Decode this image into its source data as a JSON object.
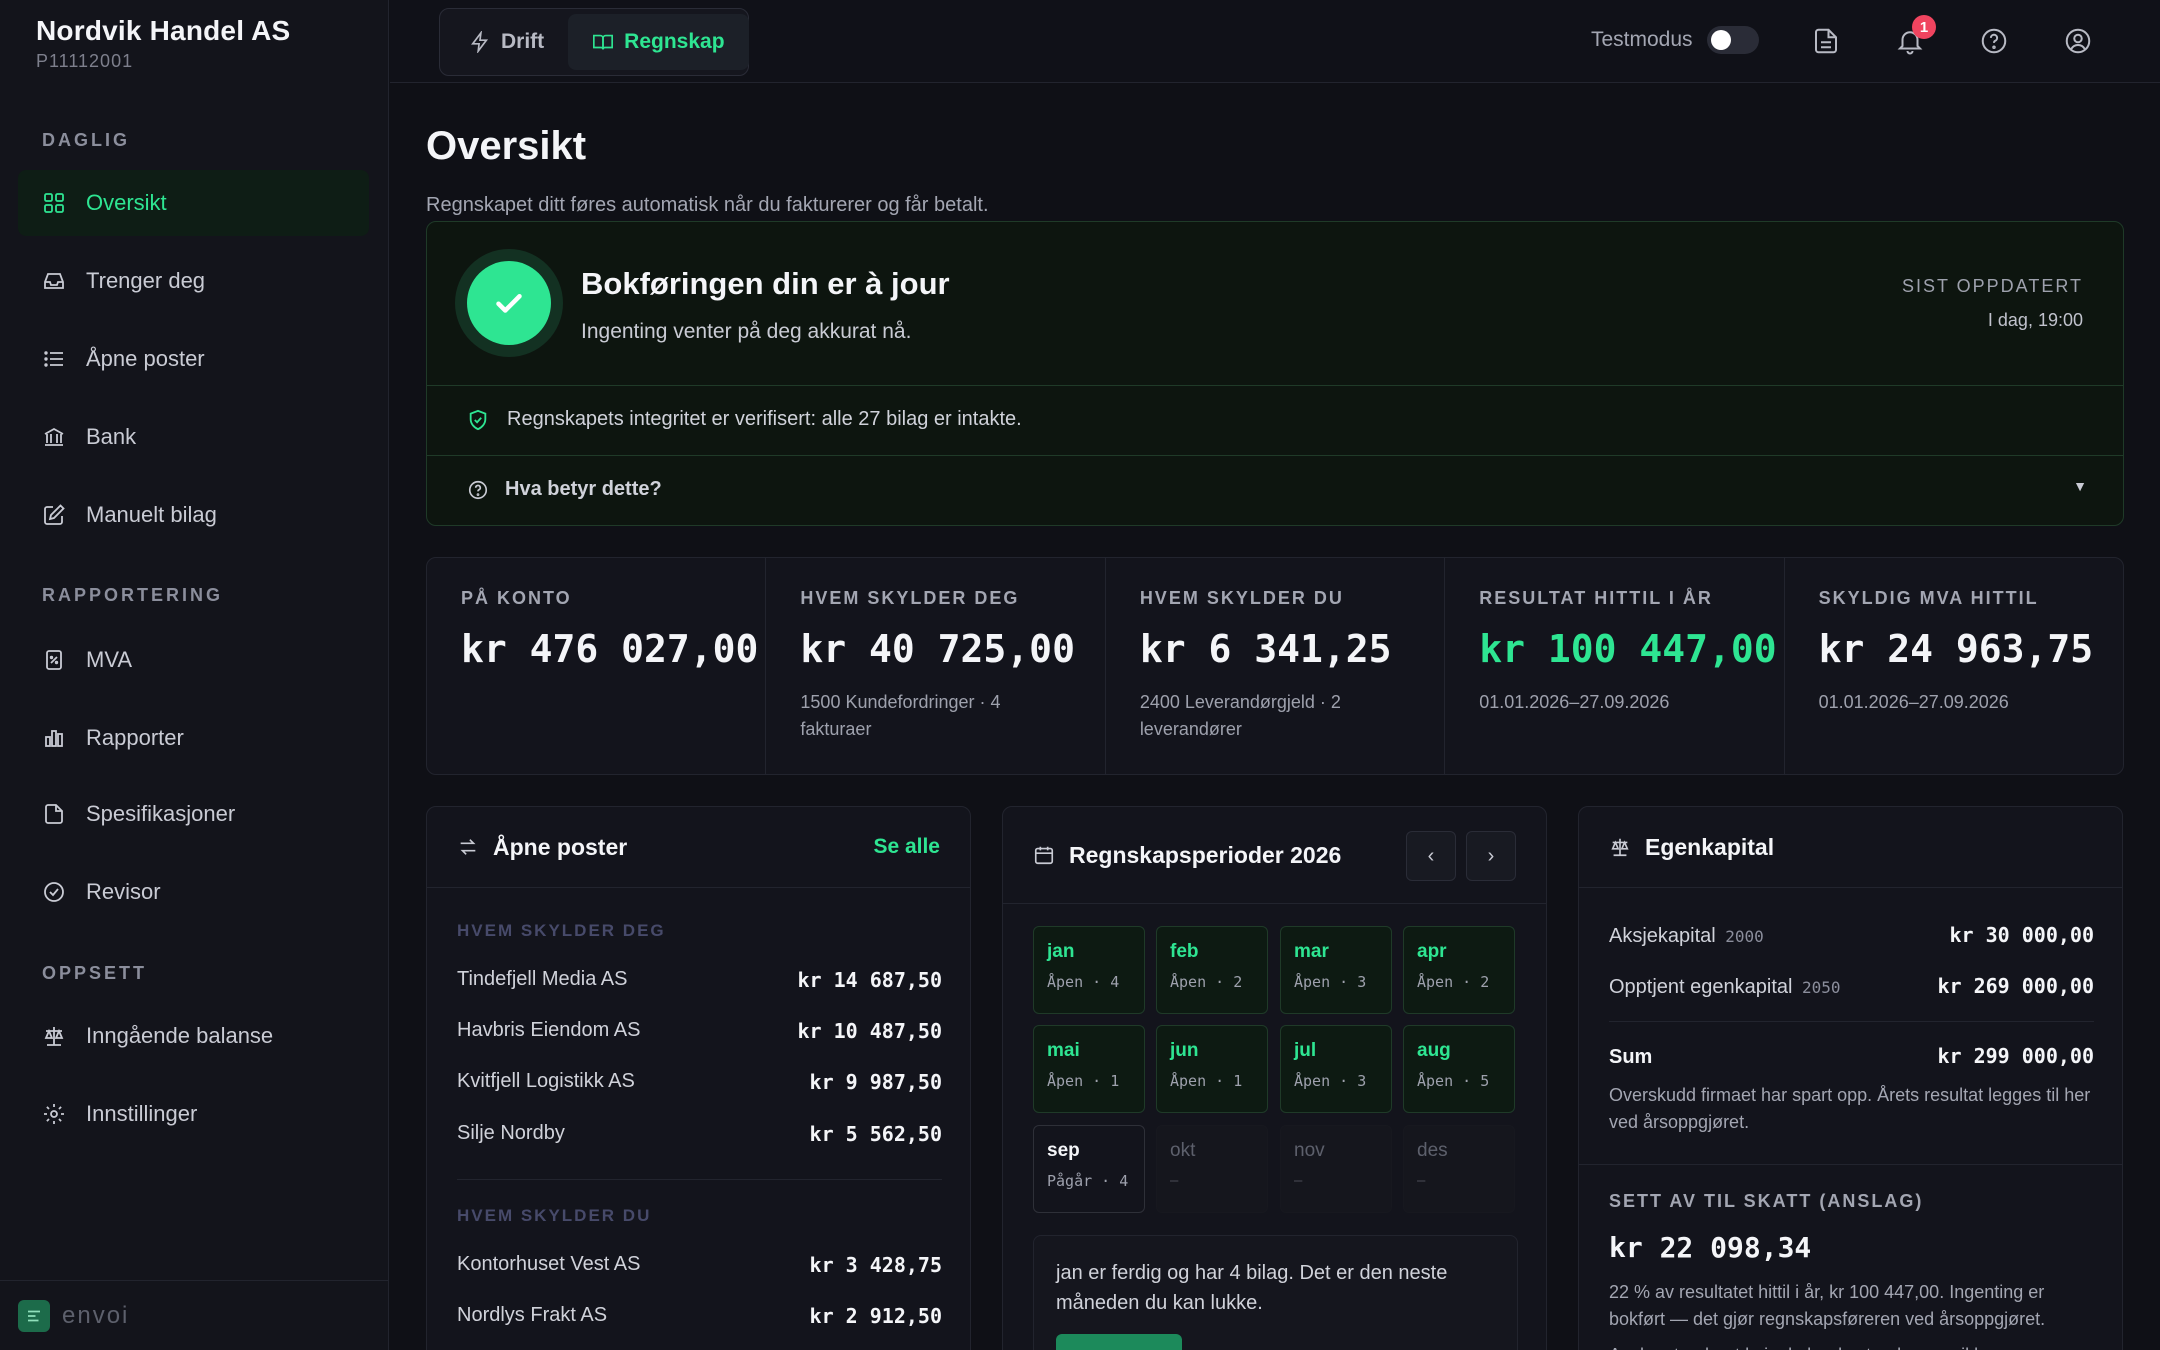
{
  "company": {
    "name": "Nordvik Handel AS",
    "id": "P11112001"
  },
  "sidebar": {
    "sections": [
      "DAGLIG",
      "RAPPORTERING",
      "OPPSETT"
    ],
    "items": [
      {
        "label": "Oversikt",
        "icon": "grid-icon"
      },
      {
        "label": "Trenger deg",
        "icon": "inbox-icon"
      },
      {
        "label": "Åpne poster",
        "icon": "list-icon"
      },
      {
        "label": "Bank",
        "icon": "bank-icon"
      },
      {
        "label": "Manuelt bilag",
        "icon": "edit-icon"
      },
      {
        "label": "MVA",
        "icon": "tax-icon"
      },
      {
        "label": "Rapporter",
        "icon": "bar-chart-icon"
      },
      {
        "label": "Spesifikasjoner",
        "icon": "file-icon"
      },
      {
        "label": "Revisor",
        "icon": "check-circle-icon"
      },
      {
        "label": "Inngående balanse",
        "icon": "scale-icon"
      },
      {
        "label": "Innstillinger",
        "icon": "gear-icon"
      }
    ],
    "footer_logo": "envoi"
  },
  "topbar": {
    "modes": [
      "Drift",
      "Regnskap"
    ],
    "testmode_label": "Testmodus",
    "notification_count": "1"
  },
  "page": {
    "title": "Oversikt",
    "subtitle": "Regnskapet ditt føres automatisk når du fakturerer og får betalt."
  },
  "status": {
    "title": "Bokføringen din er à jour",
    "description": "Ingenting venter på deg akkurat nå.",
    "updated_label": "SIST OPPDATERT",
    "updated_value": "I dag, 19:00",
    "integrity": "Regnskapets integritet er verifisert: alle 27 bilag er intakte.",
    "faq": "Hva betyr dette?"
  },
  "stats": [
    {
      "label": "PÅ KONTO",
      "value": "kr 476 027,00",
      "sub": ""
    },
    {
      "label": "HVEM SKYLDER DEG",
      "value": "kr 40 725,00",
      "sub": "1500 Kundefordringer · 4 fakturaer"
    },
    {
      "label": "HVEM SKYLDER DU",
      "value": "kr 6 341,25",
      "sub": "2400 Leverandørgjeld · 2 leverandører"
    },
    {
      "label": "RESULTAT HITTIL I ÅR",
      "value": "kr 100 447,00",
      "sub": "01.01.2026–27.09.2026"
    },
    {
      "label": "SKYLDIG MVA HITTIL",
      "value": "kr 24 963,75",
      "sub": "01.01.2026–27.09.2026"
    }
  ],
  "open_items": {
    "title": "Åpne poster",
    "see_all": "Se alle",
    "receivable_label": "HVEM SKYLDER DEG",
    "receivables": [
      {
        "name": "Tindefjell Media AS",
        "amount": "kr 14 687,50"
      },
      {
        "name": "Havbris Eiendom AS",
        "amount": "kr 10 487,50"
      },
      {
        "name": "Kvitfjell Logistikk AS",
        "amount": "kr 9 987,50"
      },
      {
        "name": "Silje Nordby",
        "amount": "kr 5 562,50"
      }
    ],
    "payable_label": "HVEM SKYLDER DU",
    "payables": [
      {
        "name": "Kontorhuset Vest AS",
        "amount": "kr 3 428,75"
      },
      {
        "name": "Nordlys Frakt AS",
        "amount": "kr 2 912,50"
      }
    ]
  },
  "periods": {
    "title": "Regnskapsperioder 2026",
    "prev": "‹",
    "next": "›",
    "months": [
      {
        "name": "jan",
        "status": "Åpen · 4"
      },
      {
        "name": "feb",
        "status": "Åpen · 2"
      },
      {
        "name": "mar",
        "status": "Åpen · 3"
      },
      {
        "name": "apr",
        "status": "Åpen · 2"
      },
      {
        "name": "mai",
        "status": "Åpen · 1"
      },
      {
        "name": "jun",
        "status": "Åpen · 1"
      },
      {
        "name": "jul",
        "status": "Åpen · 3"
      },
      {
        "name": "aug",
        "status": "Åpen · 5"
      },
      {
        "name": "sep",
        "status": "Pågår · 4"
      },
      {
        "name": "okt",
        "status": "–"
      },
      {
        "name": "nov",
        "status": "–"
      },
      {
        "name": "des",
        "status": "–"
      }
    ],
    "note": "jan er ferdig og har 4 bilag. Det er den neste måneden du kan lukke."
  },
  "equity": {
    "title": "Egenkapital",
    "rows": [
      {
        "label": "Aksjekapital",
        "account": "2000",
        "amount": "kr 30 000,00"
      },
      {
        "label": "Opptjent egenkapital",
        "account": "2050",
        "amount": "kr 269 000,00"
      }
    ],
    "sum_label": "Sum",
    "sum_amount": "kr 299 000,00",
    "sum_note": "Overskudd firmaet har spart opp. Årets resultat legges til her ved årsoppgjøret.",
    "tax_label": "SETT AV TIL SKATT (ANSLAG)",
    "tax_value": "kr 22 098,34",
    "tax_note": "22 % av resultatet hittil i år, kr 100 447,00. Ingenting er bokført — det gjør regnskapsføreren ved årsoppgjøret.",
    "tax_note_2": "Anslaget er høyt hvis du har kostnader som ikke er"
  },
  "colors": {
    "accent": "#2ee592",
    "background": "#0f1016",
    "badge": "#f0445f"
  }
}
